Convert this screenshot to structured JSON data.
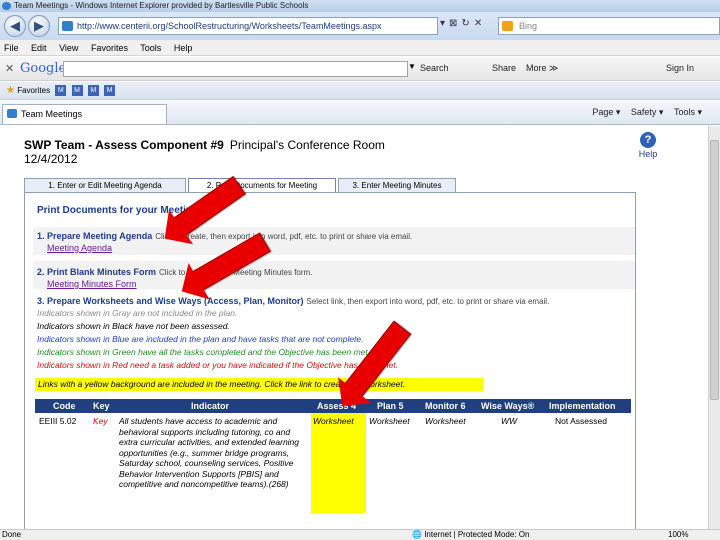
{
  "window": {
    "title": "Team Meetings - Windows Internet Explorer provided by Bartlesville Public Schools"
  },
  "addressbar": {
    "url": "http://www.centerii.org/SchoolRestructuring/Worksheets/TeamMeetings.aspx",
    "search_engine": "Bing"
  },
  "menubar": {
    "items": [
      "File",
      "Edit",
      "View",
      "Favorites",
      "Tools",
      "Help"
    ]
  },
  "googlebar": {
    "logo": "Google",
    "search_label": "Search",
    "share_label": "Share",
    "more_label": "More ≫",
    "signin_label": "Sign In"
  },
  "favbar": {
    "favorites_label": "Favorites"
  },
  "ietab": {
    "label": "Team Meetings"
  },
  "commandbar": {
    "page_label": "Page ▾",
    "safety_label": "Safety ▾",
    "tools_label": "Tools ▾"
  },
  "page": {
    "title": "SWP Team - Assess Component #9",
    "room": "Principal's Conference Room",
    "date": "12/4/2012",
    "help_label": "Help",
    "tabs": [
      {
        "label": "1. Enter or Edit Meeting Agenda"
      },
      {
        "label": "2. Print Documents for Meeting"
      },
      {
        "label": "3. Enter Meeting Minutes"
      }
    ],
    "section_title": "Print Documents for your Meeting",
    "items": [
      {
        "title": "1. Prepare Meeting Agenda",
        "desc": "Click to create, then export into word, pdf, etc. to print or share via email.",
        "link": "Meeting Agenda"
      },
      {
        "title": "2. Print Blank Minutes Form",
        "desc": "Click to print a blank Meeting Minutes form.",
        "link": "Meeting Minutes Form"
      },
      {
        "title": "3. Prepare Worksheets and Wise Ways (Access, Plan, Monitor)",
        "desc": "Select link, then export into word, pdf, etc. to print or share via email."
      }
    ],
    "indicators": [
      {
        "text": "Indicators shown in Gray are not included in the plan.",
        "color": "#8a8a8a"
      },
      {
        "text": "Indicators shown in Black have not been assessed.",
        "color": "#000000"
      },
      {
        "text": "Indicators shown in Blue are included in the plan and have tasks that are not complete.",
        "color": "#1f3fbf"
      },
      {
        "text": "Indicators shown in Green have all the tasks completed and the Objective has been met.",
        "color": "#1f8f1f"
      },
      {
        "text": "Indicators shown in Red need a task added or you have indicated if the Objective has been met.",
        "color": "#d01010"
      }
    ],
    "yellow_note": "Links with a yellow background are included in the meeting. Click the link to create the worksheet.",
    "table": {
      "headers": [
        "Code",
        "Key",
        "Indicator",
        "Assess 4",
        "Plan 5",
        "Monitor 6",
        "Wise Ways®",
        "Implementation"
      ],
      "row": {
        "code": "EEIII 5.02",
        "key": "Key",
        "indicator": "All students have access to academic and behavioral supports including tutoring, co and extra curricular activities, and extended learning opportunities (e.g., summer bridge programs, Saturday school, counseling services, Positive Behavior Intervention Supports [PBIS] and competitive and noncompetitive teams).(268)",
        "assess": "Worksheet",
        "plan": "Worksheet",
        "monitor": "Worksheet",
        "wiseways": "WW",
        "implementation": "Not Assessed"
      }
    }
  },
  "statusbar": {
    "left": "Done",
    "zone": "Internet | Protected Mode: On",
    "zoom": "100%"
  }
}
